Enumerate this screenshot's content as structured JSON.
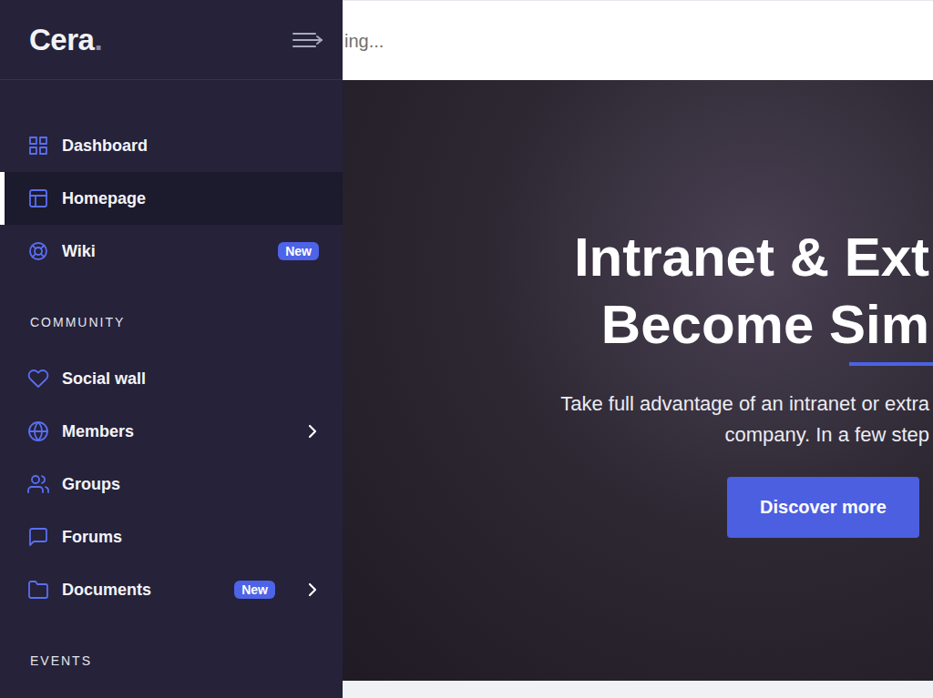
{
  "sidebar": {
    "logo": {
      "text": "Cera",
      "dot": "."
    },
    "sections": [
      {
        "heading": null,
        "items": [
          {
            "label": "Dashboard",
            "selected": false,
            "badge": null,
            "expandable": false
          },
          {
            "label": "Homepage",
            "selected": true,
            "badge": null,
            "expandable": false
          },
          {
            "label": "Wiki",
            "selected": false,
            "badge": "New",
            "expandable": false
          }
        ]
      },
      {
        "heading": "COMMUNITY",
        "items": [
          {
            "label": "Social wall",
            "selected": false,
            "badge": null,
            "expandable": false
          },
          {
            "label": "Members",
            "selected": false,
            "badge": null,
            "expandable": true
          },
          {
            "label": "Groups",
            "selected": false,
            "badge": null,
            "expandable": false
          },
          {
            "label": "Forums",
            "selected": false,
            "badge": null,
            "expandable": false
          },
          {
            "label": "Documents",
            "selected": false,
            "badge": "New",
            "expandable": true
          }
        ]
      },
      {
        "heading": "EVENTS",
        "items": []
      }
    ]
  },
  "topbar": {
    "search_text": "ing..."
  },
  "hero": {
    "title_lines": [
      "Intranet & Ext",
      "Become Sim"
    ],
    "subtitle_lines": [
      "Take full advantage of an intranet or extra",
      "company. In a few step"
    ],
    "button": "Discover more"
  }
}
